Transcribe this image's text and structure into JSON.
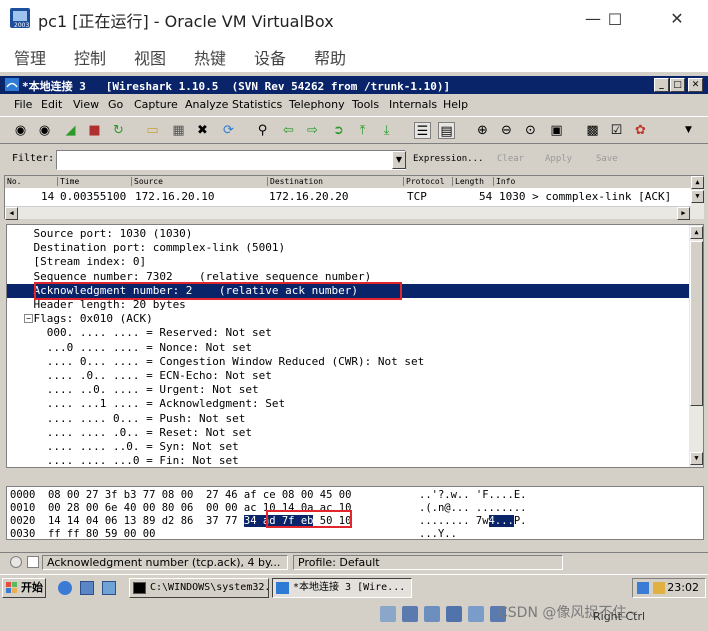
{
  "vbox": {
    "title": "pc1 [正在运行] - Oracle VM VirtualBox",
    "menu": [
      "管理",
      "控制",
      "视图",
      "热键",
      "设备",
      "帮助"
    ]
  },
  "wireshark": {
    "title": "*本地连接 3   [Wireshark 1.10.5  (SVN Rev 54262 from /trunk-1.10)]",
    "menu": [
      "File",
      "Edit",
      "View",
      "Go",
      "Capture",
      "Analyze",
      "Statistics",
      "Telephony",
      "Tools",
      "Internals",
      "Help"
    ],
    "filter": {
      "label": "Filter:",
      "value": "",
      "expression": "Expression...",
      "clear": "Clear",
      "apply": "Apply",
      "save": "Save"
    },
    "packet_list": {
      "columns": [
        "No.",
        "Time",
        "Source",
        "Destination",
        "Protocol",
        "Length",
        "Info"
      ],
      "row": {
        "no": "14",
        "time": "0.00355100",
        "source": "172.16.20.10",
        "destination": "172.16.20.20",
        "protocol": "TCP",
        "length": "54",
        "info": "1030 > commplex-link [ACK]"
      }
    },
    "details": [
      "    Source port: 1030 (1030)",
      "    Destination port: commplex-link (5001)",
      "    [Stream index: 0]",
      "    Sequence number: 7302    (relative sequence number)",
      "    Acknowledgment number: 2    (relative ack number)",
      "    Header length: 20 bytes",
      "    Flags: 0x010 (ACK)",
      "      000. .... .... = Reserved: Not set",
      "      ...0 .... .... = Nonce: Not set",
      "      .... 0... .... = Congestion Window Reduced (CWR): Not set",
      "      .... .0.. .... = ECN-Echo: Not set",
      "      .... ..0. .... = Urgent: Not set",
      "      .... ...1 .... = Acknowledgment: Set",
      "      .... .... 0... = Push: Not set",
      "      .... .... .0.. = Reset: Not set",
      "      .... .... ..0. = Syn: Not set",
      "      .... .... ...0 = Fin: Not set"
    ],
    "selected_detail_index": 4,
    "hex": {
      "offsets": [
        "0000",
        "0010",
        "0020",
        "0030"
      ],
      "row0": "08 00 27 3f b3 77 08 00  27 46 af ce 08 00 45 00",
      "row1": "00 28 00 6e 40 00 80 06  00 00 ac 10 14 0a ac 10",
      "row2_pre": "14 14 04 06 13 89 d2 86  37 77 ",
      "row2_hl": "34 ad 7f eb",
      "row2_post": " 50 10",
      "row3": "ff ff 80 59 00 00",
      "ascii0": "..'?.w.. 'F....E.",
      "ascii1": ".(.n@... ........",
      "ascii2_pre": "........ 7w",
      "ascii2_hl": "4...",
      "ascii2_post": "P.",
      "ascii3": "...Y.."
    },
    "status": {
      "field": "Acknowledgment number (tcp.ack), 4 by...",
      "profile": "Profile: Default"
    }
  },
  "taskbar": {
    "start": "开始",
    "tasks": [
      "C:\\WINDOWS\\system32...",
      "*本地连接 3   [Wire..."
    ],
    "clock": "23:02"
  },
  "vbox_status": {
    "watermark": "CSDN @像风捉不住~",
    "hostkey": "Right Ctrl"
  },
  "colors": {
    "selection": "#0a246a",
    "highlight_box": "#e2272c",
    "chrome": "#d4d0c8"
  }
}
